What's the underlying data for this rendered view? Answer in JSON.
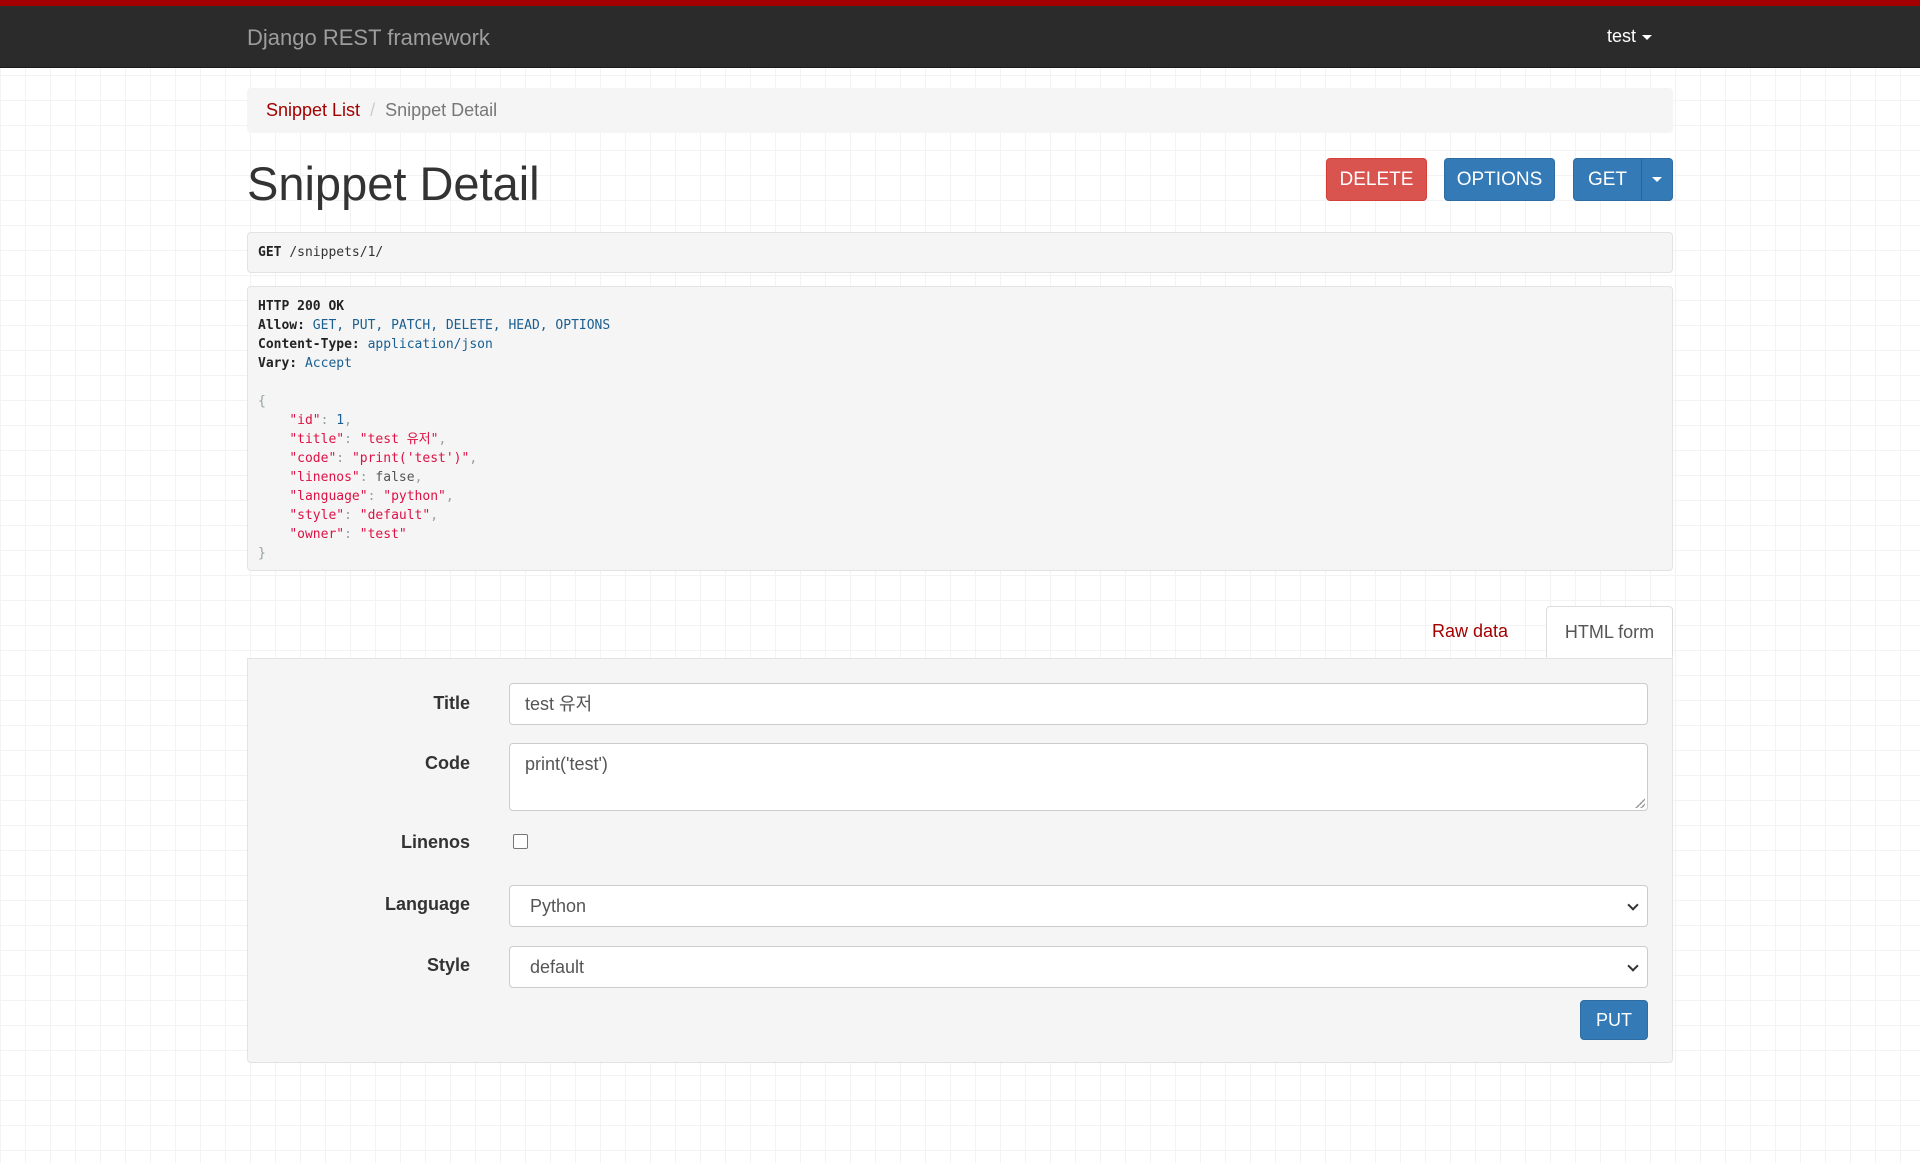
{
  "navbar": {
    "brand": "Django REST framework",
    "user": "test"
  },
  "breadcrumb": {
    "items": [
      "Snippet List",
      "Snippet Detail"
    ],
    "separator": "/"
  },
  "page": {
    "title": "Snippet Detail"
  },
  "actions": {
    "delete": "DELETE",
    "options": "OPTIONS",
    "get": "GET"
  },
  "request": {
    "method": "GET",
    "path": "/snippets/1/"
  },
  "response": {
    "status": "HTTP 200 OK",
    "headers": [
      {
        "name": "Allow:",
        "value": "GET, PUT, PATCH, DELETE, HEAD, OPTIONS"
      },
      {
        "name": "Content-Type:",
        "value": "application/json"
      },
      {
        "name": "Vary:",
        "value": "Accept"
      }
    ],
    "body": {
      "open": "{",
      "close": "}",
      "fields": [
        {
          "key": "\"id\"",
          "value": "1",
          "type": "lit",
          "comma": ","
        },
        {
          "key": "\"title\"",
          "value": "\"test 유저\"",
          "type": "str",
          "comma": ","
        },
        {
          "key": "\"code\"",
          "value": "\"print('test')\"",
          "type": "str",
          "comma": ","
        },
        {
          "key": "\"linenos\"",
          "value": "false",
          "type": "plain",
          "comma": ","
        },
        {
          "key": "\"language\"",
          "value": "\"python\"",
          "type": "str",
          "comma": ","
        },
        {
          "key": "\"style\"",
          "value": "\"default\"",
          "type": "str",
          "comma": ","
        },
        {
          "key": "\"owner\"",
          "value": "\"test\"",
          "type": "str",
          "comma": ""
        }
      ]
    }
  },
  "tabs": {
    "raw": "Raw data",
    "html": "HTML form"
  },
  "form": {
    "title_label": "Title",
    "title_value": "test 유저",
    "code_label": "Code",
    "code_value": "print('test')",
    "linenos_label": "Linenos",
    "linenos_checked": false,
    "language_label": "Language",
    "language_value": "Python",
    "style_label": "Style",
    "style_value": "default",
    "submit": "PUT"
  },
  "colors": {
    "brand_red": "#a30000",
    "navbar_bg": "#2b2b2b",
    "danger": "#d9534f",
    "primary": "#337ab7"
  }
}
